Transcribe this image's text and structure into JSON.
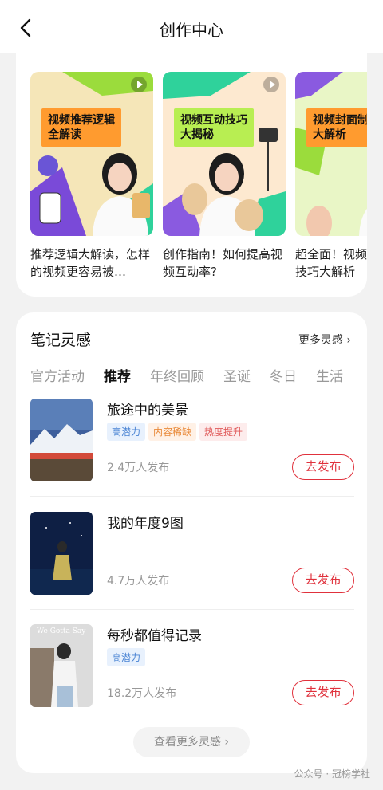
{
  "header": {
    "title": "创作中心"
  },
  "videos": [
    {
      "banner": "视频推荐逻辑\n全解读",
      "caption": "推荐逻辑大解读，怎样的视频更容易被…",
      "banner_color": "#ff9b2f",
      "bg_color": "#f5e6b8",
      "accent": "#9bdc3c"
    },
    {
      "banner": "视频互动技巧\n大揭秘",
      "caption": "创作指南！如何提高视频互动率?",
      "banner_color": "#b8ee52",
      "bg_color": "#fde9d0",
      "accent": "#2fd29b"
    },
    {
      "banner": "视频封面制作\n大解析",
      "caption": "超全面！视频封面制作技巧大解析",
      "banner_color": "#ff9b2f",
      "bg_color": "#e9f6c6",
      "accent": "#8a5ae0"
    }
  ],
  "inspiration": {
    "title": "笔记灵感",
    "more": "更多灵感",
    "tabs": [
      "官方活动",
      "推荐",
      "年终回顾",
      "圣诞",
      "冬日",
      "生活"
    ],
    "active_tab": "推荐",
    "items": [
      {
        "title": "旅途中的美景",
        "badges": [
          "高潜力",
          "内容稀缺",
          "热度提升"
        ],
        "count": "2.4万人发布",
        "button": "去发布"
      },
      {
        "title": "我的年度9图",
        "badges": [],
        "count": "4.7万人发布",
        "button": "去发布"
      },
      {
        "title": "每秒都值得记录",
        "badges": [
          "高潜力"
        ],
        "count": "18.2万人发布",
        "button": "去发布"
      }
    ],
    "view_more": "查看更多灵感",
    "thumb3_text": "We Gotta Say"
  },
  "watermark": "公众号 · 冠榜学社"
}
